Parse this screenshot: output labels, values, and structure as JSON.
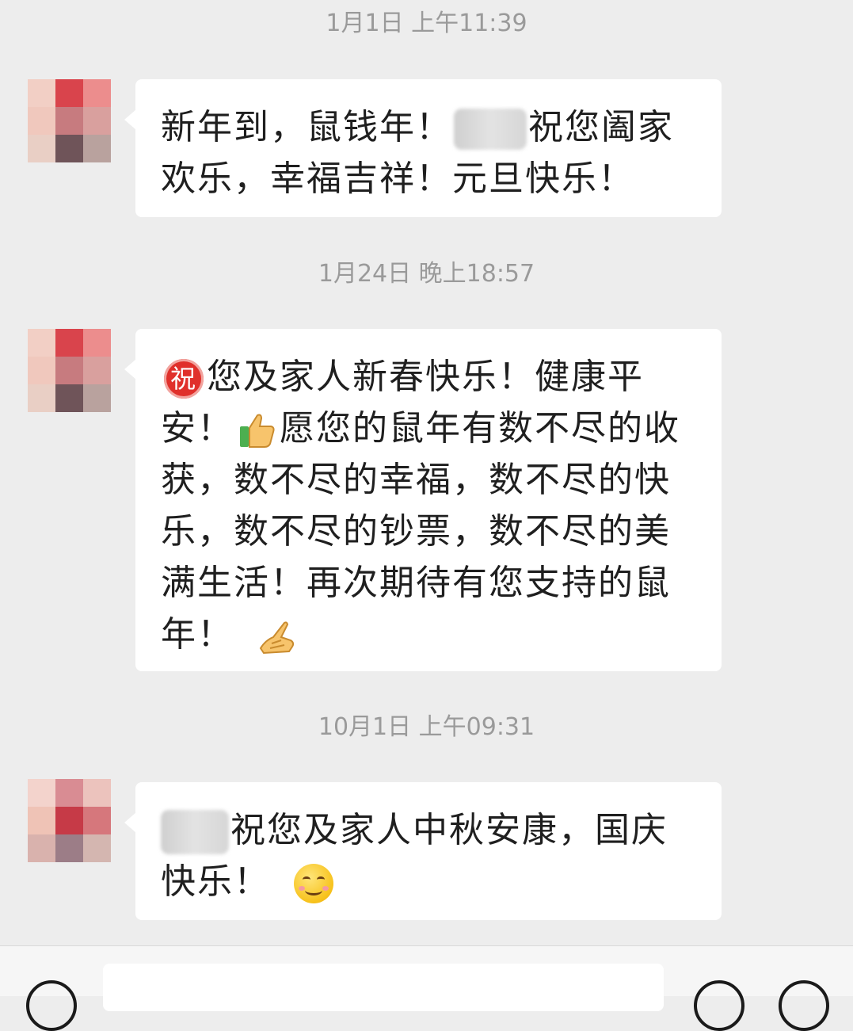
{
  "messages": [
    {
      "timestamp": "1月1日 上午11:39",
      "text_a": "新年到，鼠钱年！",
      "text_b": "祝您阖家欢乐，幸福吉祥！元旦快乐！"
    },
    {
      "timestamp": "1月24日 晚上18:57",
      "emoji_1": "祝",
      "text_a": "您及家人新春快乐！健康平安！",
      "emoji_2_icon": "thumbs-up-icon",
      "text_b": "愿您的鼠年有数不尽的收获，数不尽的幸福，数不尽的快乐，数不尽的钞票，数不尽的美满生活！再次期待有您支持的鼠年！",
      "emoji_3_icon": "fist-bump-icon"
    },
    {
      "timestamp": "10月1日 上午09:31",
      "text_a": "祝您及家人中秋安康，国庆快乐！",
      "emoji_icon": "smile-icon"
    }
  ],
  "colors": {
    "background": "#ededed",
    "bubble": "#ffffff",
    "timestamp": "#9a9a9a",
    "text": "#1f1f1f"
  },
  "bottom_bar": {
    "left_icon": "voice-icon",
    "right_icons": [
      "emoji-icon",
      "add-icon"
    ]
  }
}
